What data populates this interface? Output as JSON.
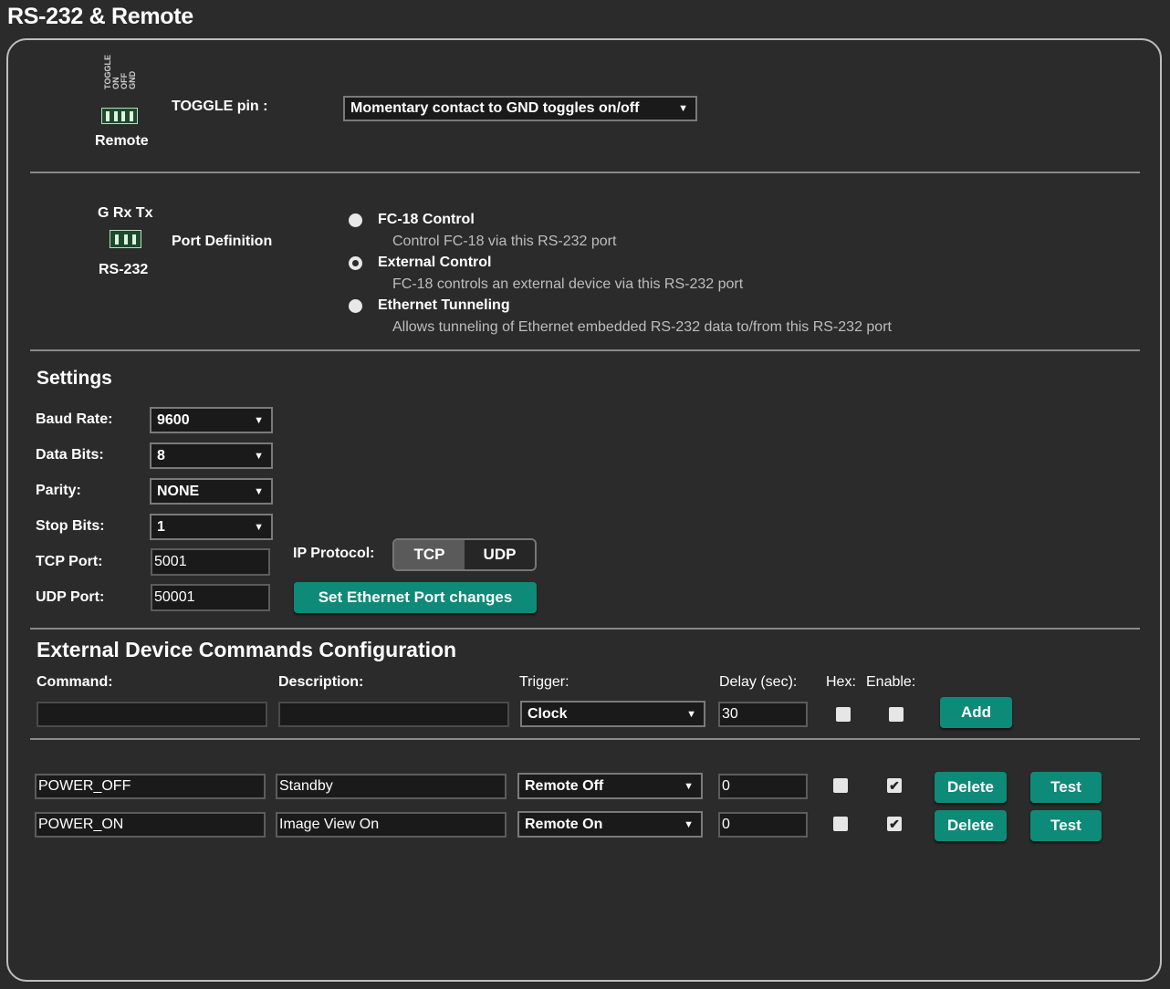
{
  "page": {
    "title": "RS-232 & Remote"
  },
  "remote": {
    "pin_labels": [
      "TOGGLE",
      "ON",
      "OFF",
      "GND"
    ],
    "label": "Remote",
    "toggle_label": "TOGGLE pin :",
    "toggle_value": "Momentary contact to GND toggles on/off"
  },
  "rs232": {
    "pins_label": "G Rx Tx",
    "label": "RS-232",
    "port_definition_label": "Port Definition",
    "options": [
      {
        "title": "FC-18 Control",
        "desc": "Control FC-18 via this RS-232 port",
        "selected": false
      },
      {
        "title": "External Control",
        "desc": "FC-18 controls an external device via this RS-232 port",
        "selected": true
      },
      {
        "title": "Ethernet Tunneling",
        "desc": "Allows tunneling of Ethernet embedded RS-232 data to/from this RS-232 port",
        "selected": false
      }
    ]
  },
  "settings": {
    "heading": "Settings",
    "baud_label": "Baud Rate:",
    "baud_value": "9600",
    "databits_label": "Data Bits:",
    "databits_value": "8",
    "parity_label": "Parity:",
    "parity_value": "NONE",
    "stopbits_label": "Stop Bits:",
    "stopbits_value": "1",
    "tcp_label": "TCP Port:",
    "tcp_value": "5001",
    "udp_label": "UDP Port:",
    "udp_value": "50001",
    "ip_protocol_label": "IP Protocol:",
    "ip_protocol_options": [
      "TCP",
      "UDP"
    ],
    "ip_protocol_selected": "TCP",
    "set_button": "Set Ethernet Port changes"
  },
  "commands": {
    "heading": "External Device Commands Configuration",
    "col_command": "Command:",
    "col_description": "Description:",
    "col_trigger": "Trigger:",
    "col_delay": "Delay (sec):",
    "col_hex": "Hex:",
    "col_enable": "Enable:",
    "new_row": {
      "command": "",
      "description": "",
      "trigger": "Clock",
      "delay": "30",
      "hex": false,
      "enable": false,
      "add_label": "Add"
    },
    "rows": [
      {
        "command": "POWER_OFF",
        "description": "Standby",
        "trigger": "Remote Off",
        "delay": "0",
        "hex": false,
        "enable": true
      },
      {
        "command": "POWER_ON",
        "description": "Image View On",
        "trigger": "Remote On",
        "delay": "0",
        "hex": false,
        "enable": true
      }
    ],
    "delete_label": "Delete",
    "test_label": "Test",
    "check_mark": "✔"
  }
}
